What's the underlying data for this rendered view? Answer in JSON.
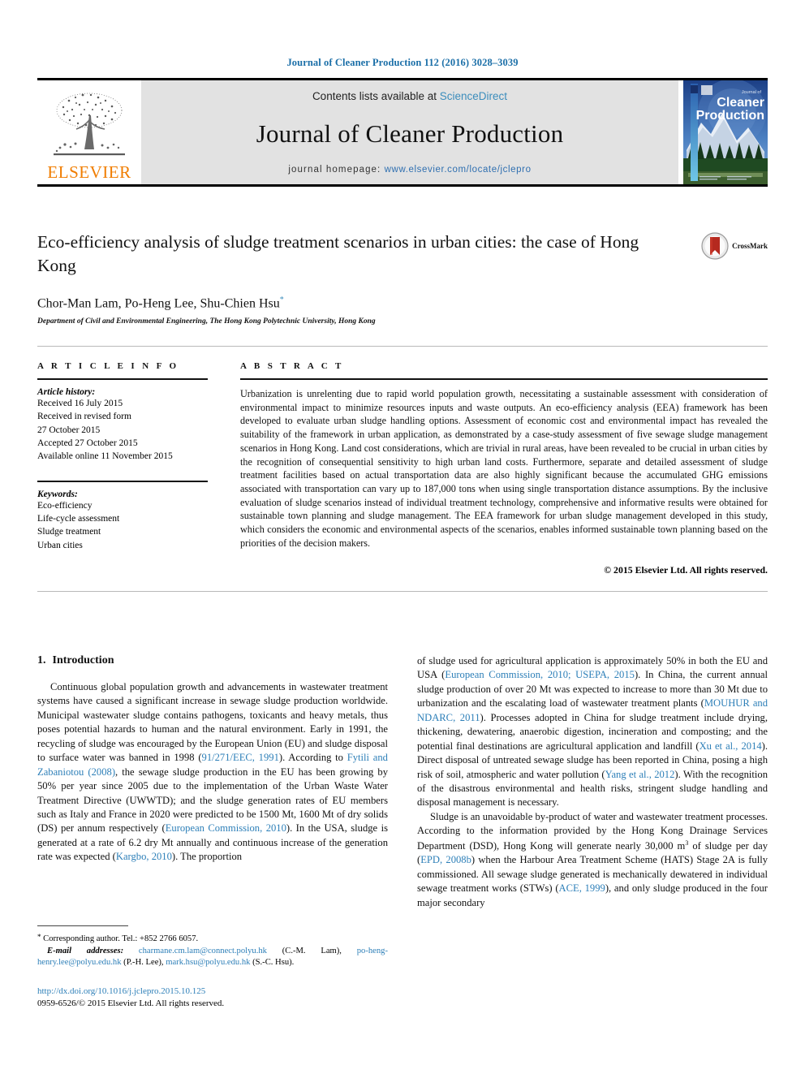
{
  "running_head": "Journal of Cleaner Production 112 (2016) 3028–3039",
  "masthead": {
    "contents_prefix": "Contents lists available at ",
    "sciencedirect": "ScienceDirect",
    "journal_title": "Journal of Cleaner Production",
    "homepage_prefix": "journal homepage: ",
    "homepage_url": "www.elsevier.com/locate/jclepro",
    "publisher": "ELSEVIER",
    "cover_line1": "Journal of",
    "cover_line2": "Cleaner",
    "cover_line3": "Production"
  },
  "title_block": {
    "title": "Eco-efficiency analysis of sludge treatment scenarios in urban cities: the case of Hong Kong",
    "authors": "Chor-Man Lam, Po-Heng Lee, Shu-Chien Hsu",
    "author_marker": "*",
    "affiliation": "Department of Civil and Environmental Engineering, The Hong Kong Polytechnic University, Hong Kong",
    "crossmark_label": "CrossMark"
  },
  "article_info": {
    "heading": "A R T I C L E   I N F O",
    "history_label": "Article history:",
    "history": [
      "Received 16 July 2015",
      "Received in revised form",
      "27 October 2015",
      "Accepted 27 October 2015",
      "Available online 11 November 2015"
    ],
    "keywords_label": "Keywords:",
    "keywords": [
      "Eco-efficiency",
      "Life-cycle assessment",
      "Sludge treatment",
      "Urban cities"
    ]
  },
  "abstract": {
    "heading": "A B S T R A C T",
    "text": "Urbanization is unrelenting due to rapid world population growth, necessitating a sustainable assessment with consideration of environmental impact to minimize resources inputs and waste outputs. An eco-efficiency analysis (EEA) framework has been developed to evaluate urban sludge handling options. Assessment of economic cost and environmental impact has revealed the suitability of the framework in urban application, as demonstrated by a case-study assessment of five sewage sludge management scenarios in Hong Kong. Land cost considerations, which are trivial in rural areas, have been revealed to be crucial in urban cities by the recognition of consequential sensitivity to high urban land costs. Furthermore, separate and detailed assessment of sludge treatment facilities based on actual transportation data are also highly significant because the accumulated GHG emissions associated with transportation can vary up to 187,000 tons when using single transportation distance assumptions. By the inclusive evaluation of sludge scenarios instead of individual treatment technology, comprehensive and informative results were obtained for sustainable town planning and sludge management. The EEA framework for urban sludge management developed in this study, which considers the economic and environmental aspects of the scenarios, enables informed sustainable town planning based on the priorities of the decision makers.",
    "copyright": "© 2015 Elsevier Ltd. All rights reserved."
  },
  "body": {
    "section_number": "1.",
    "section_title": "Introduction",
    "left_paragraph_1_a": "Continuous global population growth and advancements in wastewater treatment systems have caused a significant increase in sewage sludge production worldwide. Municipal wastewater sludge contains pathogens, toxicants and heavy metals, thus poses potential hazards to human and the natural environment. Early in 1991, the recycling of sludge was encouraged by the European Union (EU) and sludge disposal to surface water was banned in 1998 (",
    "ref_1": "91/271/EEC, 1991",
    "left_paragraph_1_b": "). According to ",
    "ref_2": "Fytili and Zabaniotou (2008)",
    "left_paragraph_1_c": ", the sewage sludge production in the EU has been growing by 50% per year since 2005 due to the implementation of the Urban Waste Water Treatment Directive (UWWTD); and the sludge generation rates of EU members such as Italy and France in 2020 were predicted to be 1500 Mt, 1600 Mt of dry solids (DS) per annum respectively (",
    "ref_3": "European Commission, 2010",
    "left_paragraph_1_d": "). In the USA, sludge is generated at a rate of 6.2 dry Mt annually and continuous increase of the generation rate was expected (",
    "ref_4": "Kargbo, 2010",
    "left_paragraph_1_e": "). The proportion",
    "right_paragraph_1_a": "of sludge used for agricultural application is approximately 50% in both the EU and USA (",
    "ref_5": "European Commission, 2010; USEPA, 2015",
    "right_paragraph_1_b": "). In China, the current annual sludge production of over 20 Mt was expected to increase to more than 30 Mt due to urbanization and the escalating load of wastewater treatment plants (",
    "ref_6": "MOUHUR and NDARC, 2011",
    "right_paragraph_1_c": "). Processes adopted in China for sludge treatment include drying, thickening, dewatering, anaerobic digestion, incineration and composting; and the potential final destinations are agricultural application and landfill (",
    "ref_7": "Xu et al., 2014",
    "right_paragraph_1_d": "). Direct disposal of untreated sewage sludge has been reported in China, posing a high risk of soil, atmospheric and water pollution (",
    "ref_8": "Yang et al., 2012",
    "right_paragraph_1_e": "). With the recognition of the disastrous environmental and health risks, stringent sludge handling and disposal management is necessary.",
    "right_paragraph_2_a": "Sludge is an unavoidable by-product of water and wastewater treatment processes. According to the information provided by the Hong Kong Drainage Services Department (DSD), Hong Kong will generate nearly 30,000 m",
    "sup_3": "3",
    "right_paragraph_2_b": " of sludge per day (",
    "ref_9": "EPD, 2008b",
    "right_paragraph_2_c": ") when the Harbour Area Treatment Scheme (HATS) Stage 2A is fully commissioned. All sewage sludge generated is mechanically dewatered in individual sewage treatment works (STWs) (",
    "ref_10": "ACE, 1999",
    "right_paragraph_2_d": "), and only sludge produced in the four major secondary"
  },
  "footnote": {
    "star": "*",
    "corresponding": " Corresponding author. Tel.: +852 2766 6057.",
    "email_label": "E-mail addresses:",
    "email_1": "charmane.cm.lam@connect.polyu.hk",
    "email_1_name": " (C.-M. Lam), ",
    "email_2": "po-heng-henry.lee@polyu.edu.hk",
    "email_2_name": " (P.-H. Lee), ",
    "email_3": "mark.hsu@polyu.edu.hk",
    "email_3_name": " (S.-C. Hsu).",
    "doi": "http://dx.doi.org/10.1016/j.jclepro.2015.10.125",
    "issn_line": "0959-6526/© 2015 Elsevier Ltd. All rights reserved."
  },
  "colors": {
    "link_blue": "#2d7fb8",
    "running_head_blue": "#1b6fa8",
    "elsevier_orange": "#f07d00",
    "masthead_grey": "#e2e2e2"
  }
}
